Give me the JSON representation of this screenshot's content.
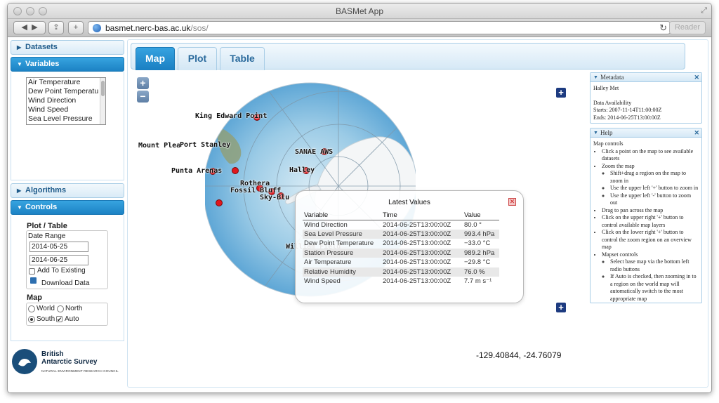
{
  "window": {
    "title": "BASMet App",
    "url_host": "basmet.nerc-bas.ac.uk",
    "url_path": "/sos/",
    "reader_label": "Reader"
  },
  "sidebar": {
    "datasets_label": "Datasets",
    "variables_label": "Variables",
    "variables": [
      "Air Temperature",
      "Dew Point Temperatu",
      "Wind Direction",
      "Wind Speed",
      "Sea Level Pressure"
    ],
    "algorithms_label": "Algorithms",
    "controls_label": "Controls",
    "plot_table_label": "Plot / Table",
    "date_range_label": "Date Range",
    "date_start": "2014-05-25",
    "date_end": "2014-06-25",
    "add_to_existing_label": "Add To Existing",
    "download_label": "Download Data",
    "map_label": "Map",
    "world_label": "World",
    "north_label": "North",
    "south_label": "South",
    "auto_label": "Auto",
    "south_selected": true,
    "auto_checked": true
  },
  "logo": {
    "line1": "British",
    "line2": "Antarctic Survey",
    "sub": "NATURAL ENVIRONMENT RESEARCH COUNCIL"
  },
  "tabs": [
    "Map",
    "Plot",
    "Table"
  ],
  "active_tab": "Map",
  "map": {
    "zoom_in": "+",
    "zoom_out": "−",
    "coordinates": "-129.40844, -24.76079",
    "stations": {
      "king_edward_point": "King Edward Point",
      "mount_pleasant": "Mount Plea",
      "port_stanley": "Port Stanley",
      "punta_arenas": "Punta Arenas",
      "sanae_aws": "SANAE AWS",
      "halley": "Halley",
      "rothera": "Rothera",
      "fossil_bluff": "Fossil Bluff",
      "sky_blu": "Sky-Blu",
      "william_field": "William Field"
    }
  },
  "popup": {
    "title": "Latest Values",
    "columns": [
      "Variable",
      "Time",
      "Value"
    ],
    "rows": [
      {
        "variable": "Wind Direction",
        "time": "2014-06-25T13:00:00Z",
        "value": "80.0 °"
      },
      {
        "variable": "Sea Level Pressure",
        "time": "2014-06-25T13:00:00Z",
        "value": "993.4 hPa"
      },
      {
        "variable": "Dew Point Temperature",
        "time": "2014-06-25T13:00:00Z",
        "value": "−33.0 °C"
      },
      {
        "variable": "Station Pressure",
        "time": "2014-06-25T13:00:00Z",
        "value": "989.2 hPa"
      },
      {
        "variable": "Air Temperature",
        "time": "2014-06-25T13:00:00Z",
        "value": "−29.8 °C"
      },
      {
        "variable": "Relative Humidity",
        "time": "2014-06-25T13:00:00Z",
        "value": "76.0 %"
      },
      {
        "variable": "Wind Speed",
        "time": "2014-06-25T13:00:00Z",
        "value": "7.7 m s⁻¹"
      }
    ]
  },
  "metadata": {
    "title": "Metadata",
    "station": "Halley Met",
    "availability_label": "Data Availability",
    "starts": "Starts: 2007-11-14T11:00:00Z",
    "ends": "Ends: 2014-06-25T13:00:00Z"
  },
  "help": {
    "title": "Help",
    "heading": "Map controls",
    "items": [
      "Click a point on the map to see available datasets",
      "Zoom the map",
      "Shift+drag a region on the map to zoom in",
      "Use the upper left '+' button to zoom in",
      "Use the upper left '-' button to zoom out",
      "Drag to pan across the map",
      "Click on the upper right '+' button to control available map layers",
      "Click on the lower right '+' button to control the zoom region on an overview map",
      "Mapset controls",
      "Select base map via the bottom left radio buttons",
      "If Auto is checked, then zooming in to a region on the world map will automatically switch to the most appropriate map"
    ]
  }
}
